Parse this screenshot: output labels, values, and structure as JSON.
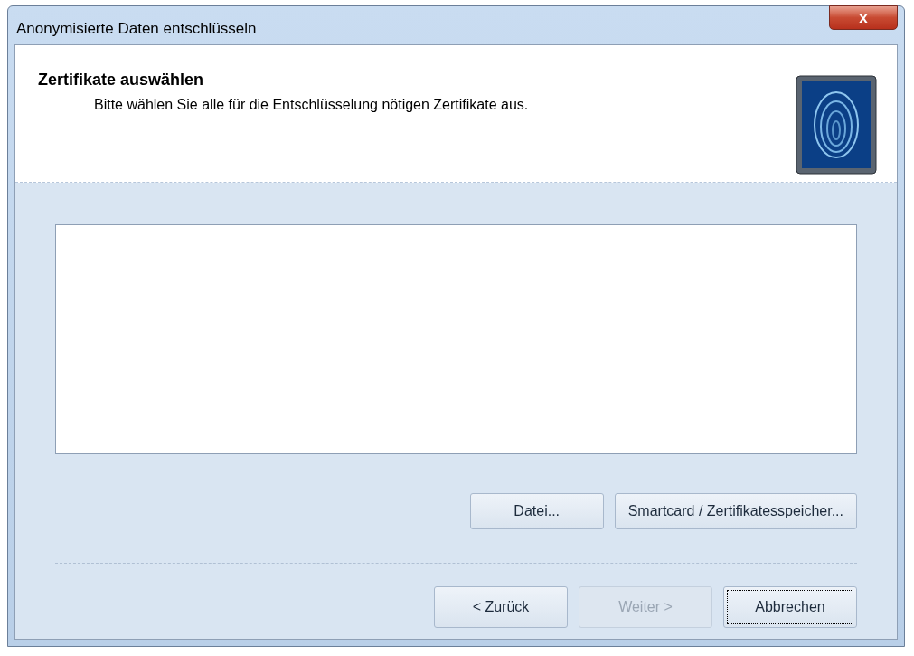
{
  "window": {
    "title": "Anonymisierte Daten entschlüsseln",
    "close": "x"
  },
  "header": {
    "title": "Zertifikate auswählen",
    "subtitle": "Bitte wählen Sie alle für die Entschlüsselung nötigen Zertifikate aus."
  },
  "source_buttons": [
    {
      "label": "Datei..."
    },
    {
      "label": "Smartcard / Zertifikatesspeicher..."
    }
  ],
  "nav_buttons": [
    {
      "before": "< ",
      "key": "Z",
      "after": "urück",
      "disabled": false,
      "focused": false
    },
    {
      "key": "W",
      "after": "eiter >",
      "disabled": true,
      "focused": false
    },
    {
      "before": "Abbrechen",
      "disabled": false,
      "focused": true
    }
  ]
}
